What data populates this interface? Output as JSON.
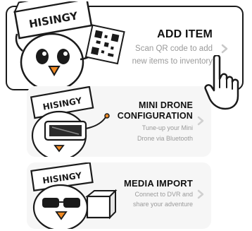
{
  "brand": {
    "box_label": "HISINGY"
  },
  "menu": {
    "items": [
      {
        "title": "ADD ITEM",
        "subtitle_line1": "Scan QR code to add",
        "subtitle_line2": "new items to inventory",
        "icon": "chevron-right-icon"
      },
      {
        "title_line1": "MINI DRONE",
        "title_line2": "CONFIGURATION",
        "subtitle_line1": "Tune-up your Mini",
        "subtitle_line2": "Drone via Bluetooth",
        "icon": "chevron-right-icon"
      },
      {
        "title": "MEDIA IMPORT",
        "subtitle_line1": "Connect to DVR and",
        "subtitle_line2": "share your adventure",
        "icon": "chevron-right-icon"
      }
    ]
  },
  "colors": {
    "accent": "#1a1a1a",
    "muted_text": "#9a9a9a",
    "card_bg": "#f6f6f6",
    "mascot_yellow": "#f2cf3a",
    "mascot_orange": "#f08a24"
  }
}
